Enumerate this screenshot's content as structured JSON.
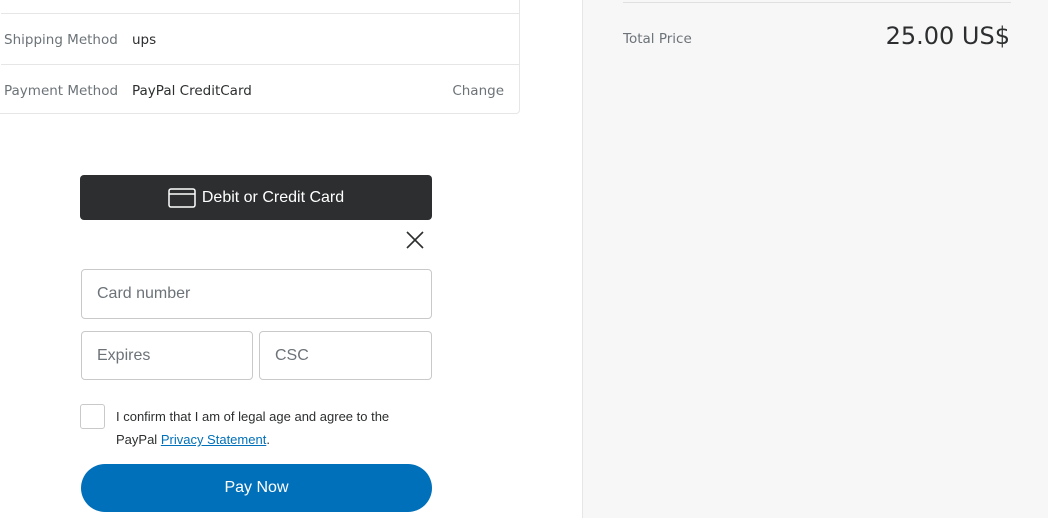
{
  "summary": {
    "shipping_method": {
      "label": "Shipping Method",
      "value": "ups"
    },
    "payment_method": {
      "label": "Payment Method",
      "value": "PayPal CreditCard",
      "action": "Change"
    }
  },
  "payment_form": {
    "card_button_label": "Debit or Credit Card",
    "card_number_placeholder": "Card number",
    "expires_placeholder": "Expires",
    "csc_placeholder": "CSC",
    "consent_text": "I confirm that I am of legal age and agree to the PayPal",
    "privacy_link": "Privacy Statement",
    "consent_end": ".",
    "pay_button_label": "Pay Now"
  },
  "order_total": {
    "label": "Total Price",
    "value": "25.00 US$"
  },
  "icons": {
    "card": "credit-card-icon",
    "close": "close-icon"
  },
  "colors": {
    "card_button_bg": "#2c2e2f",
    "pay_button_bg": "#0070ba",
    "link": "#0070ba",
    "panel_bg": "#f7f7f7"
  }
}
